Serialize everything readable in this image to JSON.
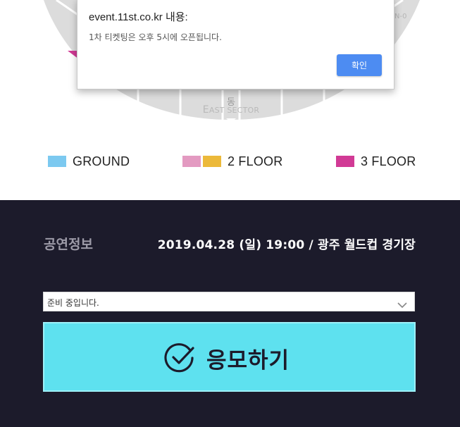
{
  "stadium": {
    "sector_name": "동",
    "sector_sub_first": "E",
    "sector_sub_rest": "AST SECTOR",
    "edge_left": "",
    "edge_right": "N-0"
  },
  "legend": {
    "items": [
      {
        "label": "GROUND",
        "colors": [
          "#7cc9f0"
        ]
      },
      {
        "label": "2 FLOOR",
        "colors": [
          "#e39ac1",
          "#ecb93a"
        ]
      },
      {
        "label": "3 FLOOR",
        "colors": [
          "#d13a95"
        ]
      }
    ]
  },
  "dialog": {
    "title": "event.11st.co.kr 내용:",
    "message": "1차 티켓팅은 오후 5시에 오픈됩니다.",
    "ok_label": "확인",
    "ok_color": "#4d8cf2"
  },
  "info": {
    "label": "공연정보",
    "value": "2019.04.28 (일) 19:00 / 광주 월드컵 경기장"
  },
  "select": {
    "value": "준비 중입니다."
  },
  "apply": {
    "label": "응모하기",
    "bg_color": "#5ee1ef"
  },
  "colors": {
    "panel_bg": "#1c1b2b",
    "stadium_gray": "#dcdcdc"
  }
}
